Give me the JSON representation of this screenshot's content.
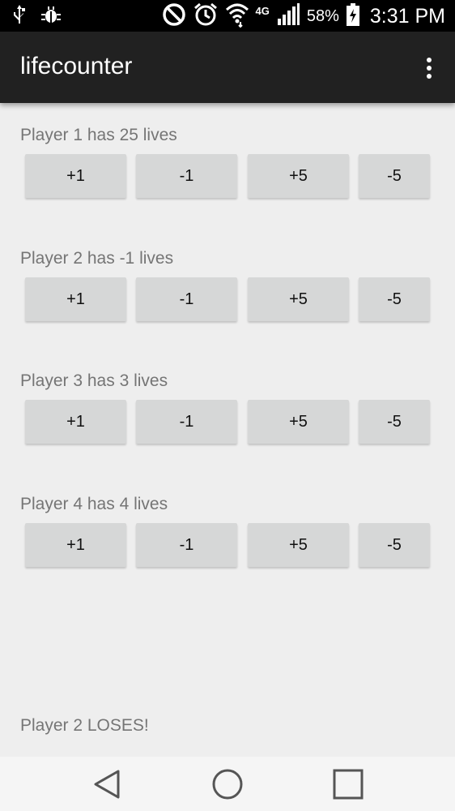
{
  "status_bar": {
    "battery_percent": "58%",
    "time": "3:31 PM",
    "network": "4G",
    "icons": [
      "usb-icon",
      "debug-icon",
      "do-not-disturb-icon",
      "alarm-icon",
      "wifi-icon",
      "signal-icon",
      "battery-charging-icon"
    ]
  },
  "app_bar": {
    "title": "lifecounter",
    "menu_icon": "overflow-menu-icon"
  },
  "players": [
    {
      "label": "Player 1 has 25 lives",
      "buttons": [
        "+1",
        "-1",
        "+5",
        "-5"
      ]
    },
    {
      "label": "Player 2 has -1 lives",
      "buttons": [
        "+1",
        "-1",
        "+5",
        "-5"
      ]
    },
    {
      "label": "Player 3 has 3 lives",
      "buttons": [
        "+1",
        "-1",
        "+5",
        "-5"
      ]
    },
    {
      "label": "Player 4 has 4 lives",
      "buttons": [
        "+1",
        "-1",
        "+5",
        "-5"
      ]
    }
  ],
  "result_text": "Player 2 LOSES!",
  "nav_bar": {
    "icons": [
      "back-icon",
      "home-icon",
      "recents-icon"
    ]
  },
  "colors": {
    "status_bar_bg": "#000000",
    "app_bar_bg": "#212121",
    "page_bg": "#eeeeee",
    "button_bg": "#d6d7d7",
    "label_text": "#757575"
  }
}
